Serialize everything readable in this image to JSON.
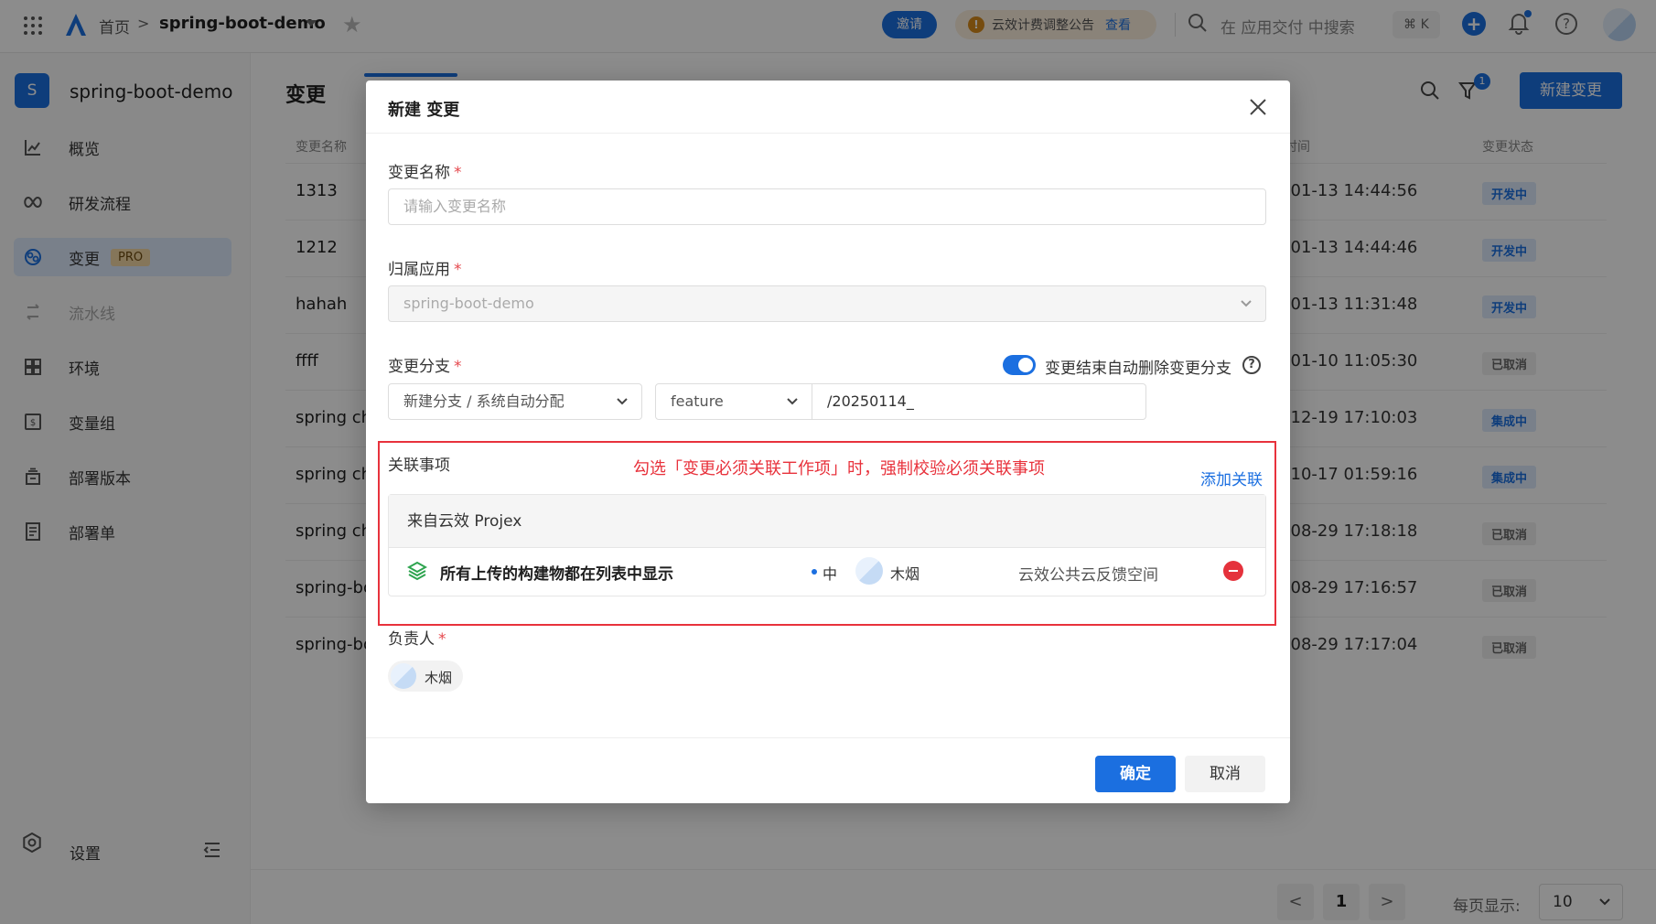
{
  "topbar": {
    "home": "首页",
    "separator": ">",
    "app_name": "spring-boot-demo",
    "invite": "邀请",
    "notice_text": "云效计费调整公告",
    "notice_link": "查看",
    "search_placeholder": "在 应用交付 中搜索",
    "shortcut": "⌘ K"
  },
  "sidebar": {
    "project_initial": "S",
    "project_name": "spring-boot-demo",
    "items": [
      {
        "label": "概览",
        "icon": "overview-icon"
      },
      {
        "label": "研发流程",
        "icon": "workflow-icon"
      },
      {
        "label": "变更",
        "icon": "change-icon",
        "badge": "PRO",
        "active": true
      },
      {
        "label": "流水线",
        "icon": "pipeline-icon",
        "disabled": true
      },
      {
        "label": "环境",
        "icon": "environment-icon"
      },
      {
        "label": "变量组",
        "icon": "variable-group-icon"
      },
      {
        "label": "部署版本",
        "icon": "deploy-version-icon"
      },
      {
        "label": "部署单",
        "icon": "deploy-order-icon"
      }
    ],
    "settings": "设置"
  },
  "main": {
    "title": "变更",
    "filter_count": "1",
    "new_button": "新建变更",
    "columns": {
      "name": "变更名称",
      "time": "时间",
      "status": "变更状态"
    },
    "rows": [
      {
        "name": "1313",
        "time": "-01-13 14:44:56",
        "status": "开发中"
      },
      {
        "name": "1212",
        "time": "-01-13 14:44:46",
        "status": "开发中"
      },
      {
        "name": "hahah",
        "time": "-01-13 11:31:48",
        "status": "开发中"
      },
      {
        "name": "ffff",
        "time": "-01-10 11:05:30",
        "status": "已取消"
      },
      {
        "name": "spring ch",
        "time": "-12-19 17:10:03",
        "status": "集成中"
      },
      {
        "name": "spring ch",
        "time": "-10-17 01:59:16",
        "status": "集成中"
      },
      {
        "name": "spring ch",
        "time": "-08-29 17:18:18",
        "status": "已取消"
      },
      {
        "name": "spring-bo",
        "time": "-08-29 17:16:57",
        "status": "已取消"
      },
      {
        "name": "spring-bo",
        "time": "-08-29 17:17:04",
        "status": "已取消"
      }
    ],
    "pager": {
      "prev": "<",
      "current": "1",
      "next": ">",
      "per_page_label": "每页显示:",
      "per_page": "10"
    }
  },
  "modal": {
    "title": "新建 变更",
    "name_label": "变更名称",
    "name_placeholder": "请输入变更名称",
    "app_label": "归属应用",
    "app_value": "spring-boot-demo",
    "branch_label": "变更分支",
    "auto_delete_label": "变更结束自动删除变更分支",
    "auto_delete_on": true,
    "branch_mode": "新建分支 / 系统自动分配",
    "branch_prefix": "feature",
    "branch_suffix": "/20250114_",
    "related_label": "关联事项",
    "annotation": "勾选「变更必须关联工作项」时，强制校验必须关联事项",
    "add_related": "添加关联",
    "source_title": "来自云效 Projex",
    "work_item": {
      "title": "所有上传的构建物都在列表中显示",
      "priority": "中",
      "assignee": "木烟",
      "space": "云效公共云反馈空间"
    },
    "owner_label": "负责人",
    "owner_name": "木烟",
    "ok": "确定",
    "cancel": "取消"
  },
  "colors": {
    "primary": "#1b6fe0",
    "required": "#e5484d",
    "annotation": "#e8323c",
    "overlay": "rgba(0,0,0,0.45)"
  }
}
